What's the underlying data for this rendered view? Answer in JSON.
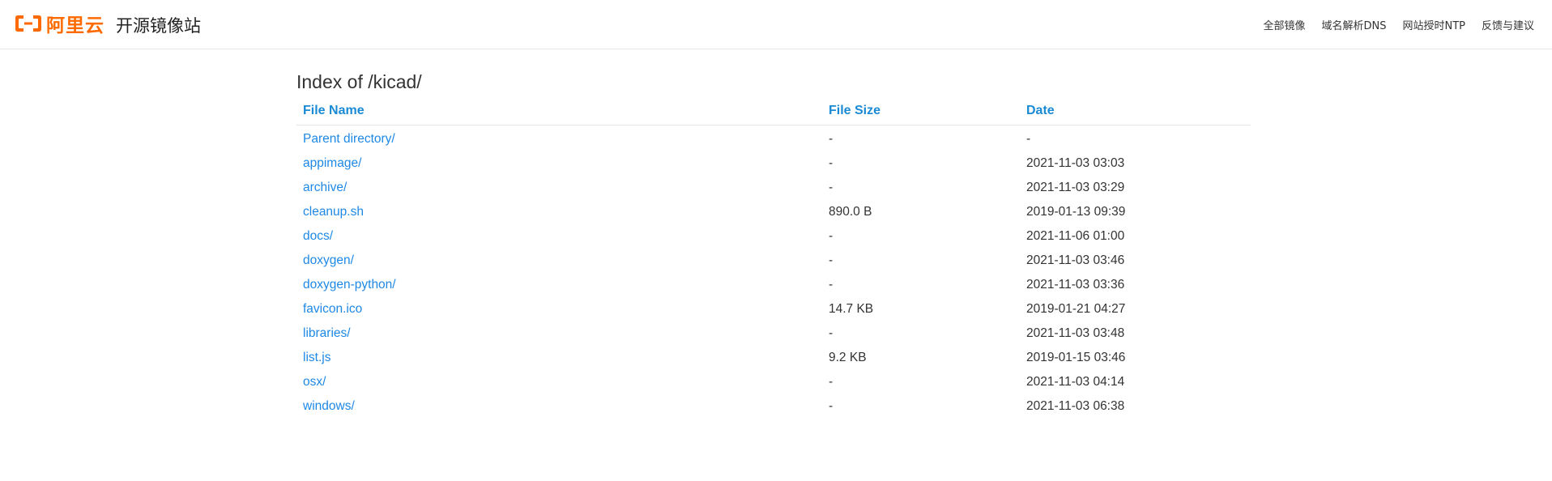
{
  "header": {
    "logo_text": "阿里云",
    "site_title": "开源镜像站",
    "nav": [
      {
        "label": "全部镜像"
      },
      {
        "label": "域名解析DNS"
      },
      {
        "label": "网站授时NTP"
      },
      {
        "label": "反馈与建议"
      }
    ]
  },
  "colors": {
    "brand": "#ff6a00",
    "link": "#1e88e5",
    "header_link": "#1a8ad4"
  },
  "listing": {
    "title": "Index of /kicad/",
    "columns": {
      "name": "File Name",
      "size": "File Size",
      "date": "Date"
    },
    "rows": [
      {
        "name": "Parent directory/",
        "size": "-",
        "date": "-"
      },
      {
        "name": "appimage/",
        "size": "-",
        "date": "2021-11-03 03:03"
      },
      {
        "name": "archive/",
        "size": "-",
        "date": "2021-11-03 03:29"
      },
      {
        "name": "cleanup.sh",
        "size": "890.0 B",
        "date": "2019-01-13 09:39"
      },
      {
        "name": "docs/",
        "size": "-",
        "date": "2021-11-06 01:00"
      },
      {
        "name": "doxygen/",
        "size": "-",
        "date": "2021-11-03 03:46"
      },
      {
        "name": "doxygen-python/",
        "size": "-",
        "date": "2021-11-03 03:36"
      },
      {
        "name": "favicon.ico",
        "size": "14.7 KB",
        "date": "2019-01-21 04:27"
      },
      {
        "name": "libraries/",
        "size": "-",
        "date": "2021-11-03 03:48"
      },
      {
        "name": "list.js",
        "size": "9.2 KB",
        "date": "2019-01-15 03:46"
      },
      {
        "name": "osx/",
        "size": "-",
        "date": "2021-11-03 04:14"
      },
      {
        "name": "windows/",
        "size": "-",
        "date": "2021-11-03 06:38"
      }
    ]
  }
}
